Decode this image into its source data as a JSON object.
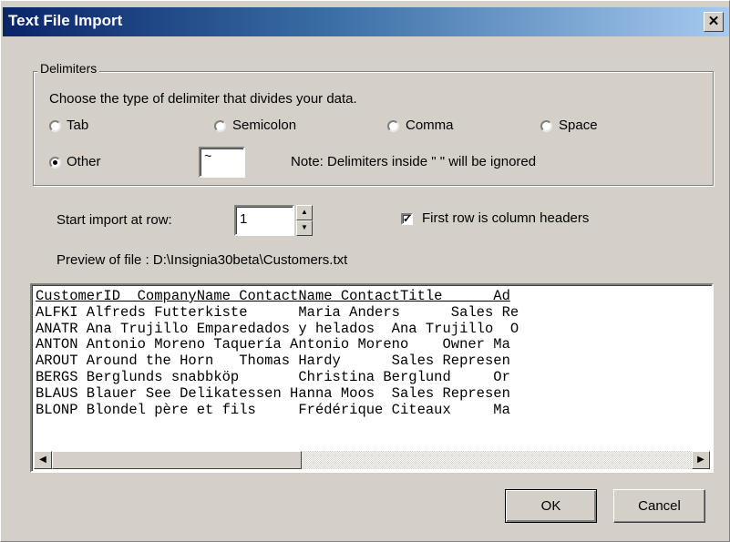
{
  "window": {
    "title": "Text File Import",
    "close_glyph": "✕"
  },
  "delimiters": {
    "group_label": "Delimiters",
    "instruction": "Choose the type of delimiter that divides your data.",
    "options": [
      {
        "label": "Tab",
        "selected": false
      },
      {
        "label": "Semicolon",
        "selected": false
      },
      {
        "label": "Comma",
        "selected": false
      },
      {
        "label": "Space",
        "selected": false
      },
      {
        "label": "Other",
        "selected": true
      }
    ],
    "other_value": "~",
    "note": "Note: Delimiters inside \"  \" will be ignored"
  },
  "import": {
    "start_row_label": "Start import at row:",
    "start_row_value": "1",
    "first_row_headers_label": "First row is column headers",
    "first_row_headers_checked": true
  },
  "preview": {
    "label": "Preview of file : D:\\Insignia30beta\\Customers.txt",
    "lines": [
      "CustomerID  CompanyName ContactName ContactTitle      Ad",
      "ALFKI Alfreds Futterkiste      Maria Anders      Sales Re",
      "ANATR Ana Trujillo Emparedados y helados  Ana Trujillo  O",
      "ANTON Antonio Moreno Taquería Antonio Moreno    Owner Ma",
      "AROUT Around the Horn   Thomas Hardy      Sales Represen",
      "BERGS Berglunds snabbköp       Christina Berglund     Or",
      "BLAUS Blauer See Delikatessen Hanna Moos  Sales Represen",
      "BLONP Blondel père et fils     Frédérique Citeaux     Ma"
    ],
    "scrollbar_position": 0.0
  },
  "buttons": {
    "ok": "OK",
    "cancel": "Cancel"
  }
}
